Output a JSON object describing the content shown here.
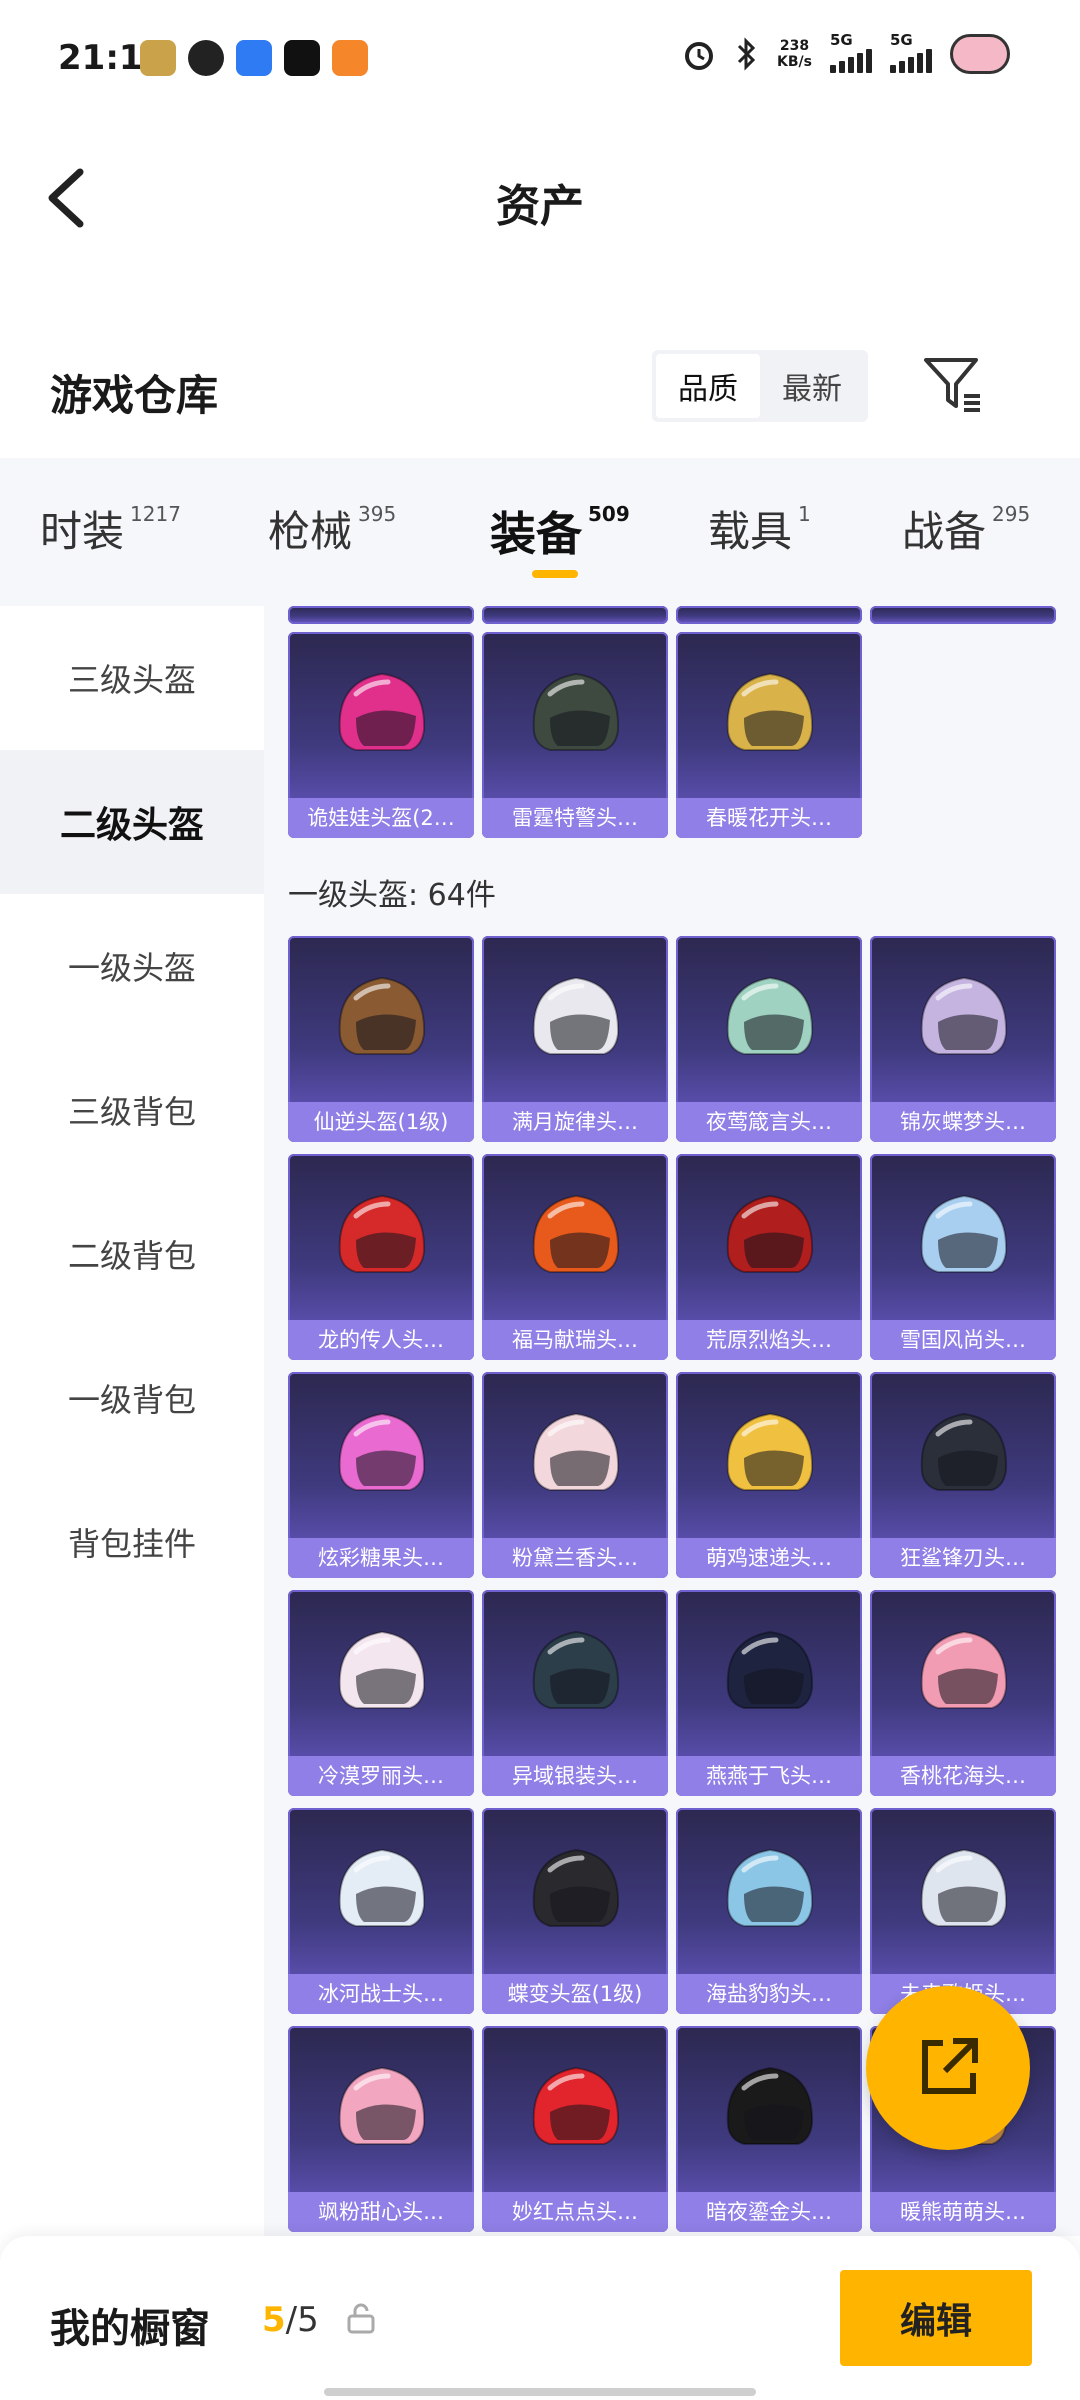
{
  "status_bar": {
    "time": "21:17",
    "net_speed_value": "238",
    "net_speed_unit": "KB/s",
    "sim1": "5G",
    "sim2": "5G"
  },
  "header": {
    "title": "资产"
  },
  "warehouse": {
    "title": "游戏仓库",
    "sort_options": [
      "品质",
      "最新"
    ],
    "sort_selected": "品质"
  },
  "tabs": [
    {
      "label": "时装",
      "count": "1217"
    },
    {
      "label": "枪械",
      "count": "395"
    },
    {
      "label": "装备",
      "count": "509"
    },
    {
      "label": "载具",
      "count": "1"
    },
    {
      "label": "战备",
      "count": "295"
    }
  ],
  "sidebar": {
    "items": [
      "三级头盔",
      "二级头盔",
      "一级头盔",
      "三级背包",
      "二级背包",
      "一级背包",
      "背包挂件"
    ],
    "active": "二级头盔"
  },
  "sections": [
    {
      "label": "",
      "items": [
        {
          "name": "诡娃娃头盔(2…",
          "color": "#e0308c"
        },
        {
          "name": "雷霆特警头…",
          "color": "#3e4a40"
        },
        {
          "name": "春暖花开头…",
          "color": "#d9b24a"
        }
      ]
    },
    {
      "label": "一级头盔: 64件",
      "items": [
        {
          "name": "仙逆头盔(1级)",
          "color": "#8a5a32"
        },
        {
          "name": "满月旋律头…",
          "color": "#e8e8ee"
        },
        {
          "name": "夜莺箴言头…",
          "color": "#9fd2c0"
        },
        {
          "name": "锦灰蝶梦头…",
          "color": "#c6b4e0"
        },
        {
          "name": "龙的传人头…",
          "color": "#d62a2a"
        },
        {
          "name": "福马献瑞头…",
          "color": "#e85a1c"
        },
        {
          "name": "荒原烈焰头…",
          "color": "#b01e1e"
        },
        {
          "name": "雪国风尚头…",
          "color": "#a8cef0"
        },
        {
          "name": "炫彩糖果头…",
          "color": "#e96ad0"
        },
        {
          "name": "粉黛兰香头…",
          "color": "#f2d7dc"
        },
        {
          "name": "萌鸡速递头…",
          "color": "#f0c040"
        },
        {
          "name": "狂鲨锋刃头…",
          "color": "#2a2f3a"
        },
        {
          "name": "冷漠罗丽头…",
          "color": "#f4e6ef"
        },
        {
          "name": "异域银装头…",
          "color": "#2b3e4a"
        },
        {
          "name": "燕燕于飞头…",
          "color": "#1e2340"
        },
        {
          "name": "香桃花海头…",
          "color": "#f29cb4"
        },
        {
          "name": "冰河战士头…",
          "color": "#e4ecf6"
        },
        {
          "name": "蝶变头盔(1级)",
          "color": "#2a2a2e"
        },
        {
          "name": "海盐豹豹头…",
          "color": "#8cc6e6"
        },
        {
          "name": "未来歌姬头…",
          "color": "#dfe5ef"
        },
        {
          "name": "飒粉甜心头…",
          "color": "#f2a6c0"
        },
        {
          "name": "妙红点点头…",
          "color": "#e2242c"
        },
        {
          "name": "暗夜鎏金头…",
          "color": "#1a1a1a"
        },
        {
          "name": "暖熊萌萌头…",
          "color": "#c48a4a"
        }
      ]
    }
  ],
  "showcase": {
    "label": "我的橱窗",
    "current": "5",
    "total": "/5",
    "edit_label": "编辑"
  },
  "colors": {
    "accent": "#ffb400",
    "card_label": "#8f7fe6"
  }
}
